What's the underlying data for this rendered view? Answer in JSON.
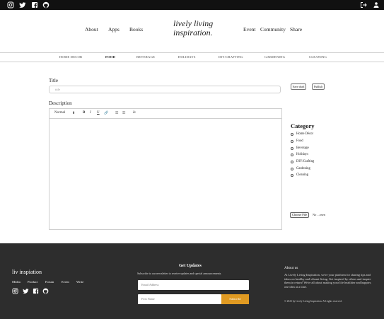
{
  "topbar": {
    "icons": [
      "instagram-icon",
      "twitter-icon",
      "facebook-icon",
      "github-icon"
    ],
    "right_icons": [
      "logout-icon",
      "user-icon"
    ]
  },
  "nav": {
    "left": [
      "About",
      "Apps",
      "Books"
    ],
    "logo_line1": "lively living",
    "logo_line2": "inspiration.",
    "right": [
      "Event",
      "Community",
      "Share"
    ]
  },
  "categories_bar": [
    "HOME DECOR",
    "FOOD",
    "BEVERAGE",
    "HOLIDAYS",
    "DIY/CRAFTING",
    "GARDENING",
    "CLEANING"
  ],
  "active_category": "FOOD",
  "form": {
    "title_label": "Title",
    "title_placeholder": "title",
    "description_label": "Description",
    "toolbar": {
      "format": "Normal",
      "format_caret": "⬍",
      "bold": "B",
      "italic": "I",
      "underline": "U",
      "link": "🔗",
      "ordered_list": "☷",
      "bullet_list": "☷",
      "clean": "Ix"
    },
    "save_draft": "Save draft",
    "publish": "Publish"
  },
  "sidebar": {
    "category_title": "Category",
    "options": [
      "Home Décor",
      "Food",
      "Beverage",
      "Holidays",
      "DIY/Crafting",
      "Gardening",
      "Cleaning"
    ],
    "file_button": "Choose File",
    "file_status": "No ...osen"
  },
  "footer": {
    "brand": "liv inspiation",
    "links": [
      "Media",
      "Product",
      "Forum",
      "Event",
      "Write"
    ],
    "updates_title": "Get Updates",
    "updates_sub": "Subscribe to our newsletter to receive updates and special announcements.",
    "email_placeholder": "Email Address",
    "firstname_placeholder": "First Name",
    "subscribe_label": "Subscribe",
    "about_title": "About us",
    "about_text": "At Lively Living Inspiration, we're your platform for sharing tips and ideas on healthy and vibrant living. Get inspired by others and inspire them in return! We're all about making your life healthier and happier, one idea at a time.",
    "copyright": "© 2023 by Lively Living Inspiration. All rights reserved."
  },
  "colors": {
    "topbar": "#111111",
    "footer": "#2d2d2d",
    "subscribe_accent": "#e09a22"
  }
}
